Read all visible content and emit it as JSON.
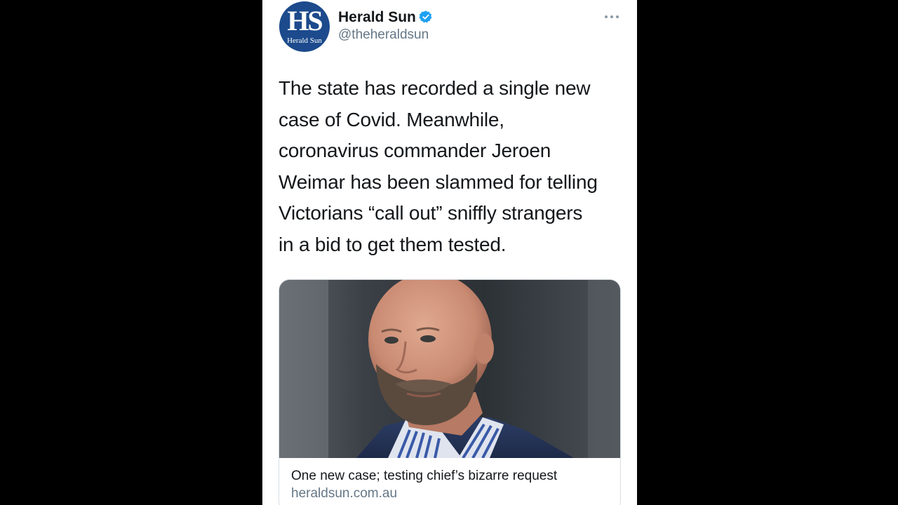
{
  "tweet": {
    "avatar": {
      "initials": "HS",
      "caption": "Herald Sun"
    },
    "display_name": "Herald Sun",
    "handle": "@theheraldsun",
    "text_lines": [
      "The state has recorded a single new",
      "case of Covid. Meanwhile,",
      "coronavirus commander Jeroen",
      "Weimar has been slammed for telling",
      "Victorians “call out” sniffly strangers",
      "in a bid to get them tested."
    ],
    "card": {
      "title": "One new case; testing chief’s bizarre request",
      "domain": "heraldsun.com.au"
    }
  },
  "icons": {
    "verified": "verified-badge-icon",
    "more": "more-horizontal-icon"
  },
  "colors": {
    "background": "#000000",
    "card_bg": "#ffffff",
    "brand_blue": "#1c4a8c",
    "verified_blue": "#1da1f2",
    "text_primary": "#14171a",
    "text_secondary": "#657786"
  }
}
